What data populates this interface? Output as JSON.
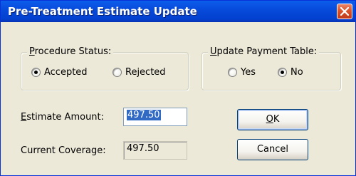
{
  "window": {
    "title": "Pre-Treatment Estimate Update"
  },
  "procedure_status": {
    "legend": "Procedure Status:",
    "options": [
      {
        "label": "Accepted",
        "selected": true
      },
      {
        "label": "Rejected",
        "selected": false
      }
    ]
  },
  "update_payment_table": {
    "legend": "Update Payment Table:",
    "options": [
      {
        "label": "Yes",
        "selected": false
      },
      {
        "label": "No",
        "selected": true
      }
    ]
  },
  "estimate_amount": {
    "label": "Estimate Amount:",
    "value": "497.50"
  },
  "current_coverage": {
    "label": "Current Coverage:",
    "value": "497.50"
  },
  "buttons": {
    "ok": "OK",
    "cancel": "Cancel"
  },
  "colors": {
    "titlebar": "#0648D8",
    "dialog_bg": "#ECE9D8",
    "selection": "#316AC5",
    "close_button": "#D9532B"
  },
  "icons": {
    "close": "close-icon"
  }
}
